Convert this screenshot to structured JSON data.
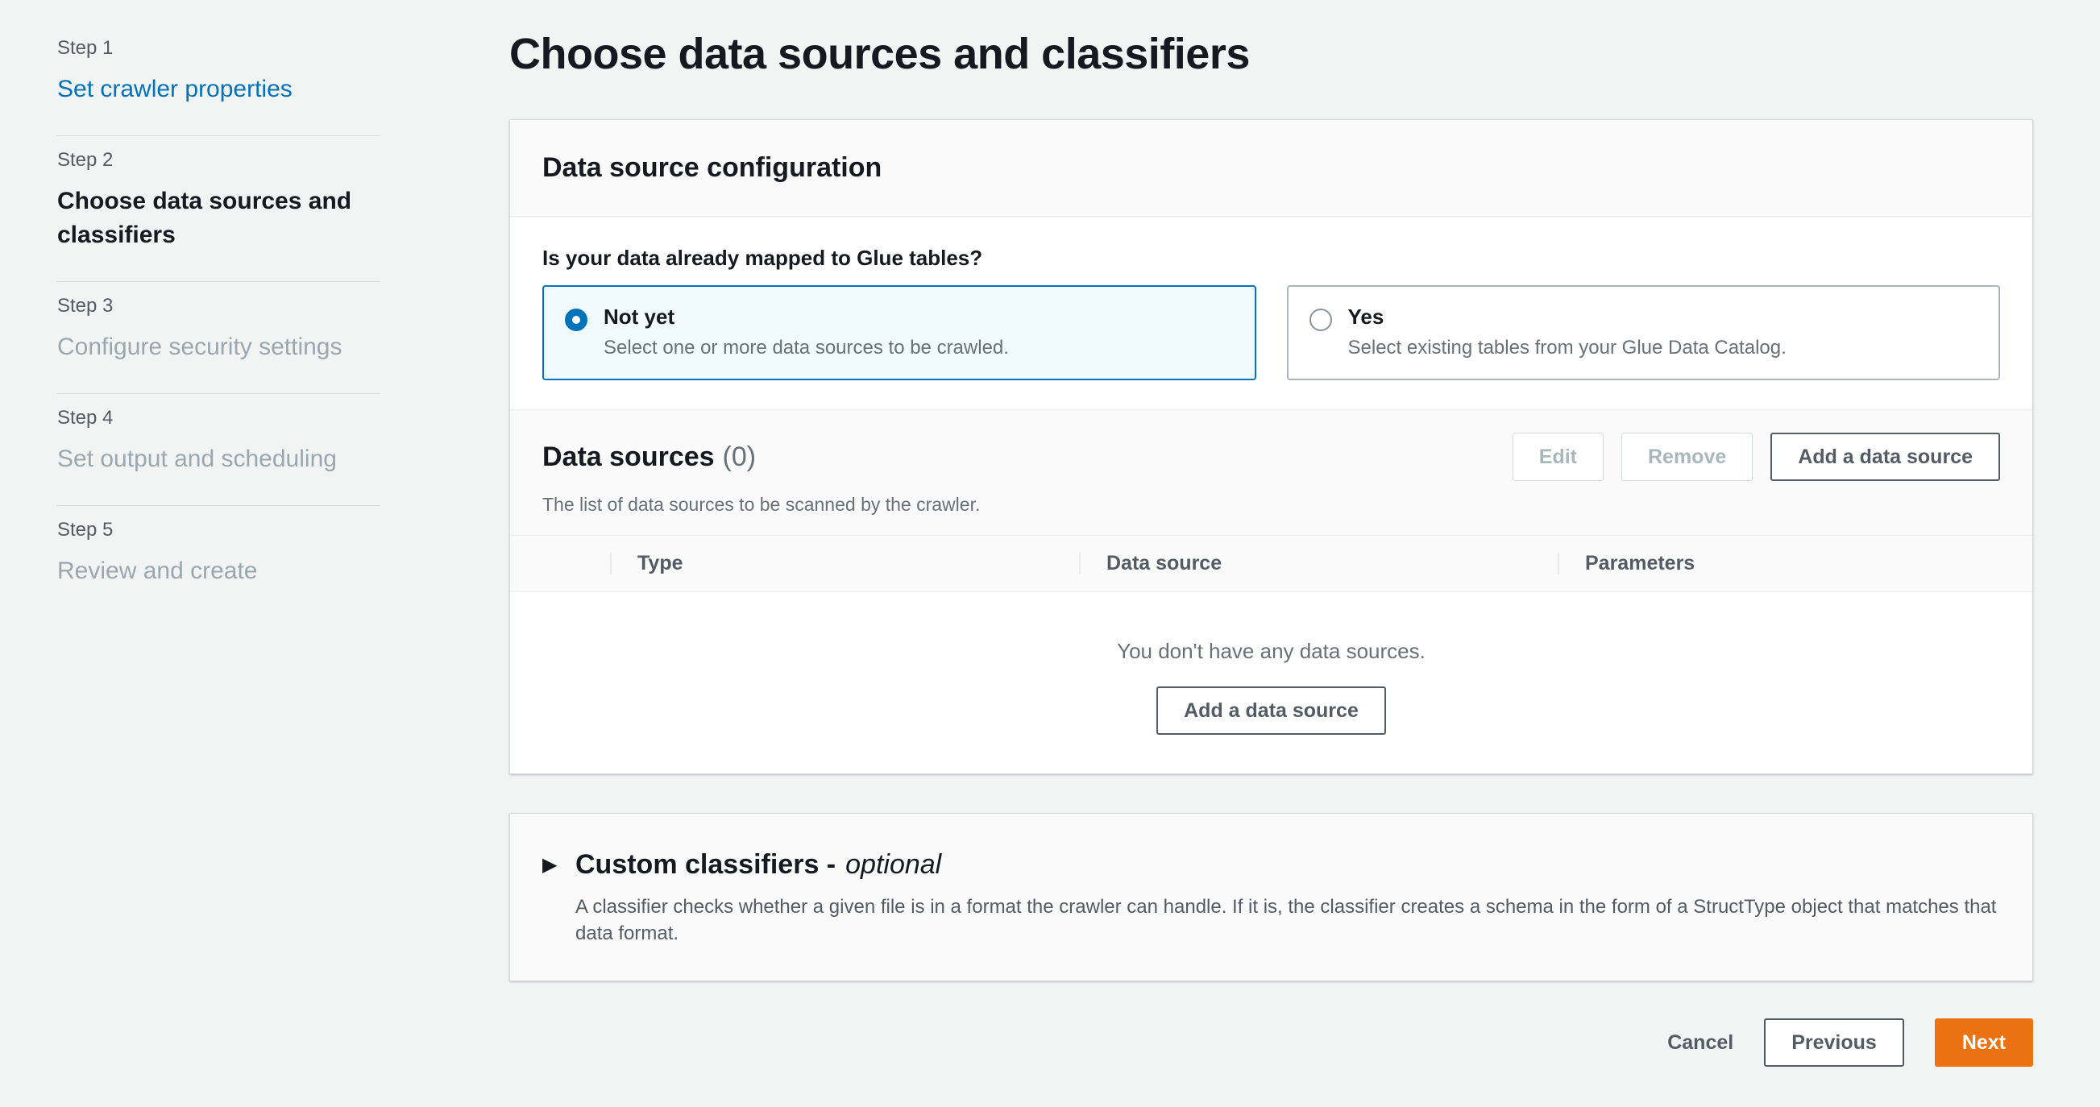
{
  "sidebar": {
    "steps": [
      {
        "label": "Step 1",
        "title": "Set crawler properties"
      },
      {
        "label": "Step 2",
        "title": "Choose data sources and classifiers"
      },
      {
        "label": "Step 3",
        "title": "Configure security settings"
      },
      {
        "label": "Step 4",
        "title": "Set output and scheduling"
      },
      {
        "label": "Step 5",
        "title": "Review and create"
      }
    ]
  },
  "page": {
    "title": "Choose data sources and classifiers"
  },
  "config_panel": {
    "title": "Data source configuration",
    "question": "Is your data already mapped to Glue tables?",
    "options": [
      {
        "label": "Not yet",
        "description": "Select one or more data sources to be crawled.",
        "selected": true
      },
      {
        "label": "Yes",
        "description": "Select existing tables from your Glue Data Catalog.",
        "selected": false
      }
    ]
  },
  "data_sources": {
    "title": "Data sources",
    "count": "(0)",
    "description": "The list of data sources to be scanned by the crawler.",
    "actions": {
      "edit": "Edit",
      "remove": "Remove",
      "add": "Add a data source"
    },
    "columns": [
      "Type",
      "Data source",
      "Parameters"
    ],
    "rows": [],
    "empty_message": "You don't have any data sources.",
    "empty_action": "Add a data source"
  },
  "classifiers": {
    "title": "Custom classifiers -",
    "optional": "optional",
    "description": "A classifier checks whether a given file is in a format the crawler can handle. If it is, the classifier creates a schema in the form of a StructType object that matches that data format."
  },
  "footer": {
    "cancel": "Cancel",
    "previous": "Previous",
    "next": "Next"
  },
  "colors": {
    "primary_button": "#ec7211",
    "link": "#0073bb",
    "selected_tile_bg": "#f1faff",
    "selected_tile_border": "#0073bb",
    "page_bg": "#f2f3f3"
  }
}
